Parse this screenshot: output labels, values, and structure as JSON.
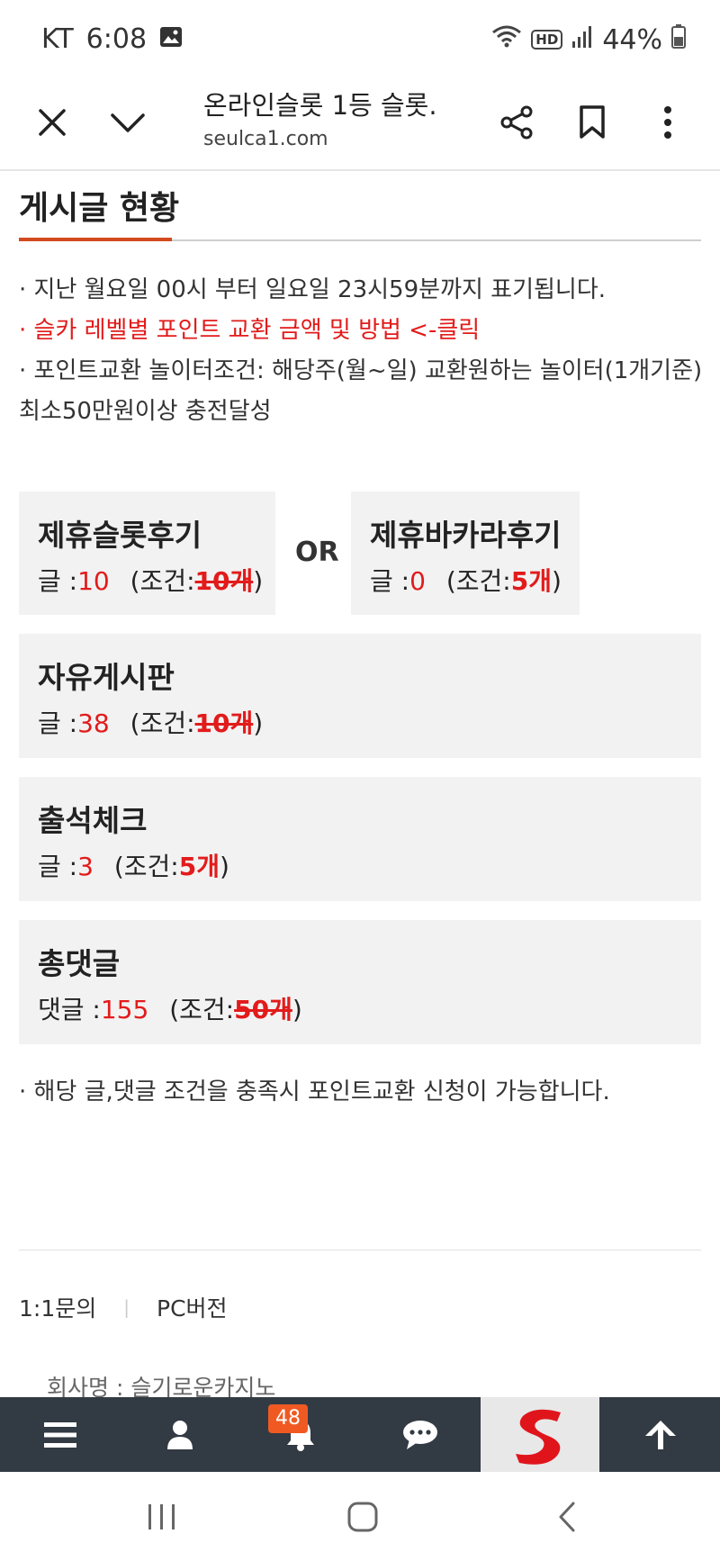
{
  "status_bar": {
    "carrier": "KT",
    "time": "6:08",
    "hd": "HD",
    "battery": "44%"
  },
  "browser": {
    "title": "온라인슬롯 1등 슬롯...",
    "url": "seulca1.com"
  },
  "page": {
    "section_title": "게시글 현황",
    "info_lines": [
      "· 지난 월요일 00시 부터 일요일 23시59분까지 표기됩니다.",
      "· 슬카 레벨별 포인트 교환 금액 및 방법 <-클릭",
      "· 포인트교환 놀이터조건: 해당주(월~일) 교환원하는 놀이터(1개기준) 최소50만원이상 충전달성"
    ],
    "or_label": "OR",
    "cards": {
      "slot": {
        "title": "제휴슬롯후기",
        "prefix": "글 :",
        "count": "10",
        "cond_open": "(조건:",
        "cond_value": "10개",
        "cond_close": ")"
      },
      "baccarat": {
        "title": "제휴바카라후기",
        "prefix": "글 :",
        "count": "0",
        "cond_open": "(조건:",
        "cond_value": "5개",
        "cond_close": ")"
      },
      "free": {
        "title": "자유게시판",
        "prefix": "글 :",
        "count": "38",
        "cond_open": "(조건:",
        "cond_value": "10개",
        "cond_close": ")"
      },
      "attendance": {
        "title": "출석체크",
        "prefix": "글 :",
        "count": "3",
        "cond_open": "(조건:",
        "cond_value": "5개",
        "cond_close": ")"
      },
      "comments": {
        "title": "총댓글",
        "prefix": "댓글 :",
        "count": "155",
        "cond_open": "(조건:",
        "cond_value": "50개",
        "cond_close": ")"
      }
    },
    "note": "· 해당 글,댓글 조건을 충족시 포인트교환 신청이 가능합니다."
  },
  "footer": {
    "inquiry": "1:1문의",
    "separator": "|",
    "pc_version": "PC버전",
    "company": "회사명 : 슬기로운카지노"
  },
  "app_nav": {
    "notification_count": "48",
    "logo_letter": "S"
  },
  "colors": {
    "accent_red": "#e21b1b",
    "title_underline": "#d24a1e",
    "nav_bg": "#323a43",
    "badge_bg": "#f05a22"
  }
}
